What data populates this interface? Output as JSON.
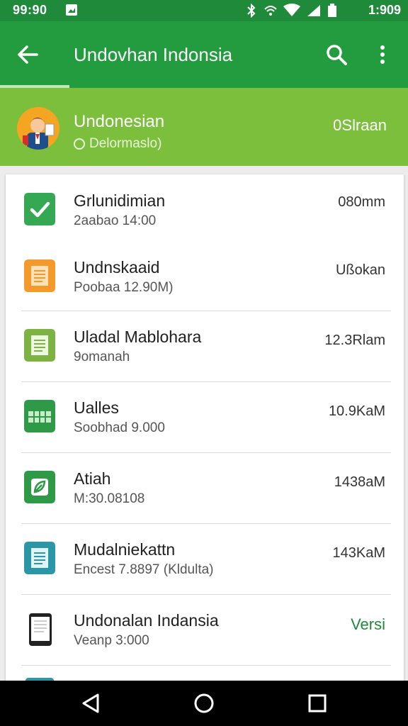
{
  "status": {
    "time": "99:90",
    "clock": "1:909"
  },
  "appbar": {
    "title": "Undovhan Indonsia"
  },
  "header": {
    "name": "Undonesian",
    "subtitle": "Delormaslo)",
    "right": "0Slraan"
  },
  "items": [
    {
      "title": "Grlunidimian",
      "subtitle": "2aabao 14:00",
      "right": "080mm",
      "icon": "check-icon",
      "color": "#34a853"
    },
    {
      "title": "Undnskaaid",
      "subtitle": "Poobaa 12.90M)",
      "right": "Ußokan",
      "icon": "document-icon",
      "color": "#f39a2b"
    },
    {
      "title": "Uladal Mablohara",
      "subtitle": "9omanah",
      "right": "12.3Rlam",
      "icon": "document-icon",
      "color": "#7cb342"
    },
    {
      "title": "Ualles",
      "subtitle": "Soobhad 9.000",
      "right": "10.9KaM",
      "icon": "sheet-icon",
      "color": "#2e9a48"
    },
    {
      "title": "Atiah",
      "subtitle": "M:30.08108",
      "right": "1438aM",
      "icon": "leaf-icon",
      "color": "#2e9a48"
    },
    {
      "title": "Mudalniekattn",
      "subtitle": "Encest 7.8897 (Kldulta)",
      "right": "143KaM",
      "icon": "document-icon",
      "color": "#2b97a6"
    },
    {
      "title": "Undonalan Indansia",
      "subtitle": "Veanp 3:000",
      "right": "Versi",
      "icon": "phone-icon",
      "color": "#222222"
    }
  ],
  "colors": {
    "status_bar": "#1e8a3a",
    "app_bar": "#239b3f",
    "header": "#7cbf3d",
    "accent_text": "#1e8a3a"
  }
}
